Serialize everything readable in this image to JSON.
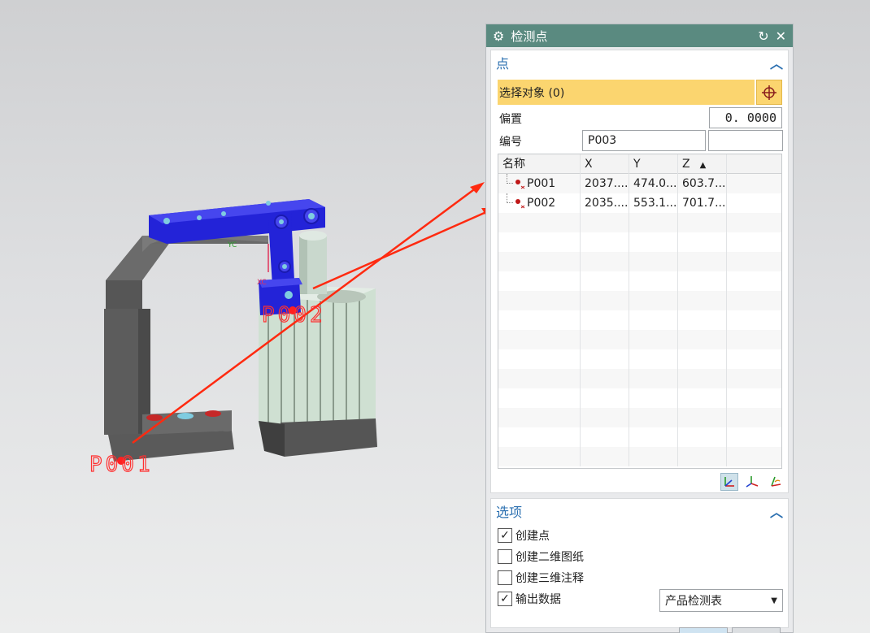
{
  "viewport": {
    "point_labels": [
      "P001",
      "P002"
    ],
    "axis_labels": {
      "yc": "YC",
      "xc": "XC"
    }
  },
  "dialog": {
    "title": "检测点",
    "point_group": {
      "header": "点",
      "select_object_label": "选择对象 (0)",
      "offset_label": "偏置",
      "offset_value": "0. 0000",
      "code_label": "编号",
      "code_value": "P003",
      "code_value2": "",
      "table": {
        "columns": [
          "名称",
          "X",
          "Y",
          "Z"
        ],
        "rows": [
          {
            "name": "P001",
            "x": "2037....",
            "y": "474.0...",
            "z": "603.7..."
          },
          {
            "name": "P002",
            "x": "2035....",
            "y": "553.1...",
            "z": "701.7..."
          }
        ]
      }
    },
    "options_group": {
      "header": "选项",
      "items": [
        {
          "label": "创建点",
          "checked": true
        },
        {
          "label": "创建二维图纸",
          "checked": false
        },
        {
          "label": "创建三维注释",
          "checked": false
        },
        {
          "label": "输出数据",
          "checked": true
        }
      ],
      "export_option": "产品检测表"
    }
  },
  "colors": {
    "titlebar": "#5a8a80",
    "highlight": "#fbd56f",
    "group_header": "#2a6fb0",
    "arrow": "#ff2a10"
  }
}
